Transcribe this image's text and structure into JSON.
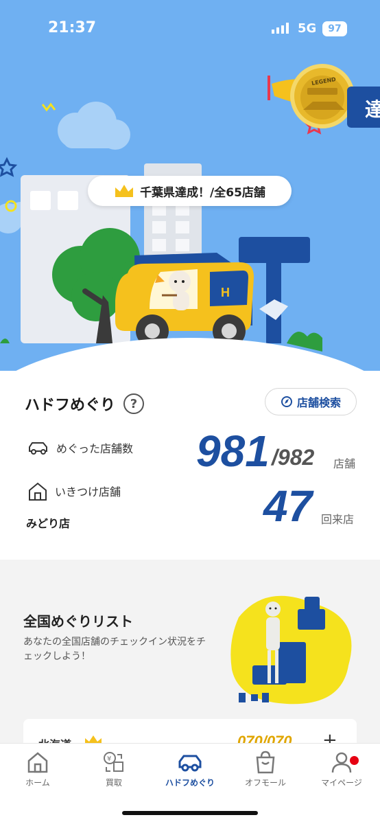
{
  "status_bar": {
    "time": "21:37",
    "network": "5G",
    "battery": "97"
  },
  "hero": {
    "achievement_text": "千葉県達成！/全65店舗",
    "legend_badge": "LEGEND",
    "flag_text": "達"
  },
  "stats": {
    "title": "ハドフめぐり",
    "search_button": "店舗検索",
    "visited_label": "めぐった店舗数",
    "visited_count": "981",
    "total_count": "/982",
    "store_unit": "店舗",
    "favorite_label": "いきつけ店舗",
    "favorite_store": "みどり店",
    "visit_count": "47",
    "visit_unit": "回来店"
  },
  "list": {
    "title": "全国めぐりリスト",
    "description": "あなたの全国店舗のチェックイン状況をチェックしよう！",
    "first_pref": {
      "name": "北海道",
      "count": "070/070"
    }
  },
  "tabs": [
    {
      "label": "ホーム",
      "icon": "home-icon"
    },
    {
      "label": "買取",
      "icon": "buyback-icon"
    },
    {
      "label": "ハドフめぐり",
      "icon": "car-icon"
    },
    {
      "label": "オフモール",
      "icon": "shopping-bag-icon"
    },
    {
      "label": "マイページ",
      "icon": "person-icon"
    }
  ],
  "colors": {
    "brand_blue": "#1d4fa0",
    "sky": "#6fb0f2",
    "car_yellow": "#f5c11d",
    "alert_red": "#e60012"
  }
}
